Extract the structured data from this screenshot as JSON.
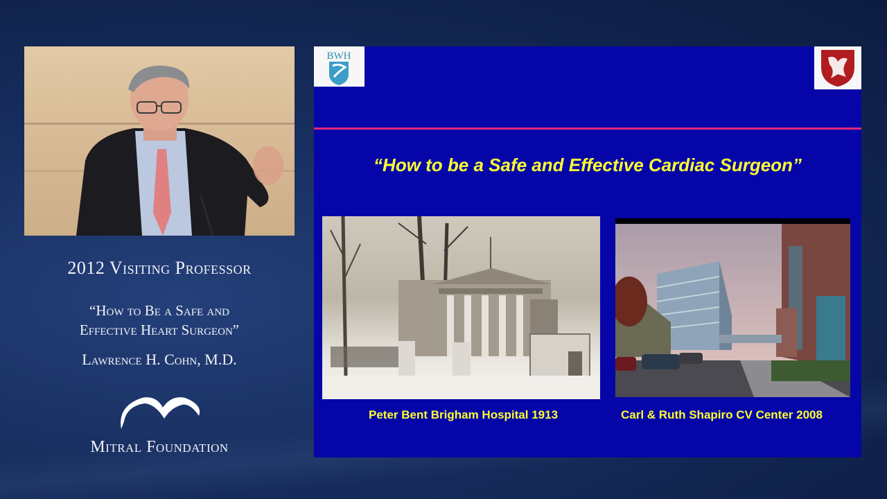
{
  "lecture": {
    "title": "2012 Visiting Professor",
    "talk_line1": "“How to Be a Safe and",
    "talk_line2": "Effective Heart Surgeon”",
    "presenter": "Lawrence H. Cohn, M.D.",
    "foundation": "Mitral Foundation"
  },
  "slide": {
    "logo_left": "BWH",
    "title": "“How to be a Safe and Effective Cardiac Surgeon”",
    "caption_left": "Peter Bent Brigham Hospital 1913",
    "caption_right": "Carl & Ruth Shapiro CV Center 2008",
    "accent_rule_color": "#e3287a",
    "title_color": "#ffff33",
    "background_color": "#0606a8"
  }
}
